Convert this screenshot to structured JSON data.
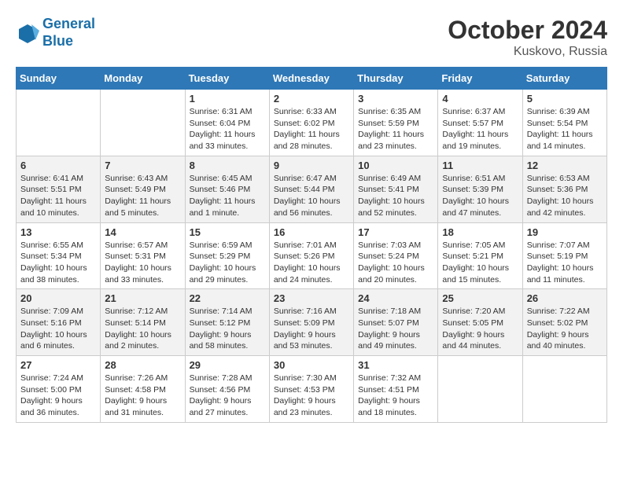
{
  "logo": {
    "line1": "General",
    "line2": "Blue"
  },
  "title": "October 2024",
  "location": "Kuskovo, Russia",
  "days_header": [
    "Sunday",
    "Monday",
    "Tuesday",
    "Wednesday",
    "Thursday",
    "Friday",
    "Saturday"
  ],
  "weeks": [
    [
      {
        "day": "",
        "info": ""
      },
      {
        "day": "",
        "info": ""
      },
      {
        "day": "1",
        "info": "Sunrise: 6:31 AM\nSunset: 6:04 PM\nDaylight: 11 hours and 33 minutes."
      },
      {
        "day": "2",
        "info": "Sunrise: 6:33 AM\nSunset: 6:02 PM\nDaylight: 11 hours and 28 minutes."
      },
      {
        "day": "3",
        "info": "Sunrise: 6:35 AM\nSunset: 5:59 PM\nDaylight: 11 hours and 23 minutes."
      },
      {
        "day": "4",
        "info": "Sunrise: 6:37 AM\nSunset: 5:57 PM\nDaylight: 11 hours and 19 minutes."
      },
      {
        "day": "5",
        "info": "Sunrise: 6:39 AM\nSunset: 5:54 PM\nDaylight: 11 hours and 14 minutes."
      }
    ],
    [
      {
        "day": "6",
        "info": "Sunrise: 6:41 AM\nSunset: 5:51 PM\nDaylight: 11 hours and 10 minutes."
      },
      {
        "day": "7",
        "info": "Sunrise: 6:43 AM\nSunset: 5:49 PM\nDaylight: 11 hours and 5 minutes."
      },
      {
        "day": "8",
        "info": "Sunrise: 6:45 AM\nSunset: 5:46 PM\nDaylight: 11 hours and 1 minute."
      },
      {
        "day": "9",
        "info": "Sunrise: 6:47 AM\nSunset: 5:44 PM\nDaylight: 10 hours and 56 minutes."
      },
      {
        "day": "10",
        "info": "Sunrise: 6:49 AM\nSunset: 5:41 PM\nDaylight: 10 hours and 52 minutes."
      },
      {
        "day": "11",
        "info": "Sunrise: 6:51 AM\nSunset: 5:39 PM\nDaylight: 10 hours and 47 minutes."
      },
      {
        "day": "12",
        "info": "Sunrise: 6:53 AM\nSunset: 5:36 PM\nDaylight: 10 hours and 42 minutes."
      }
    ],
    [
      {
        "day": "13",
        "info": "Sunrise: 6:55 AM\nSunset: 5:34 PM\nDaylight: 10 hours and 38 minutes."
      },
      {
        "day": "14",
        "info": "Sunrise: 6:57 AM\nSunset: 5:31 PM\nDaylight: 10 hours and 33 minutes."
      },
      {
        "day": "15",
        "info": "Sunrise: 6:59 AM\nSunset: 5:29 PM\nDaylight: 10 hours and 29 minutes."
      },
      {
        "day": "16",
        "info": "Sunrise: 7:01 AM\nSunset: 5:26 PM\nDaylight: 10 hours and 24 minutes."
      },
      {
        "day": "17",
        "info": "Sunrise: 7:03 AM\nSunset: 5:24 PM\nDaylight: 10 hours and 20 minutes."
      },
      {
        "day": "18",
        "info": "Sunrise: 7:05 AM\nSunset: 5:21 PM\nDaylight: 10 hours and 15 minutes."
      },
      {
        "day": "19",
        "info": "Sunrise: 7:07 AM\nSunset: 5:19 PM\nDaylight: 10 hours and 11 minutes."
      }
    ],
    [
      {
        "day": "20",
        "info": "Sunrise: 7:09 AM\nSunset: 5:16 PM\nDaylight: 10 hours and 6 minutes."
      },
      {
        "day": "21",
        "info": "Sunrise: 7:12 AM\nSunset: 5:14 PM\nDaylight: 10 hours and 2 minutes."
      },
      {
        "day": "22",
        "info": "Sunrise: 7:14 AM\nSunset: 5:12 PM\nDaylight: 9 hours and 58 minutes."
      },
      {
        "day": "23",
        "info": "Sunrise: 7:16 AM\nSunset: 5:09 PM\nDaylight: 9 hours and 53 minutes."
      },
      {
        "day": "24",
        "info": "Sunrise: 7:18 AM\nSunset: 5:07 PM\nDaylight: 9 hours and 49 minutes."
      },
      {
        "day": "25",
        "info": "Sunrise: 7:20 AM\nSunset: 5:05 PM\nDaylight: 9 hours and 44 minutes."
      },
      {
        "day": "26",
        "info": "Sunrise: 7:22 AM\nSunset: 5:02 PM\nDaylight: 9 hours and 40 minutes."
      }
    ],
    [
      {
        "day": "27",
        "info": "Sunrise: 7:24 AM\nSunset: 5:00 PM\nDaylight: 9 hours and 36 minutes."
      },
      {
        "day": "28",
        "info": "Sunrise: 7:26 AM\nSunset: 4:58 PM\nDaylight: 9 hours and 31 minutes."
      },
      {
        "day": "29",
        "info": "Sunrise: 7:28 AM\nSunset: 4:56 PM\nDaylight: 9 hours and 27 minutes."
      },
      {
        "day": "30",
        "info": "Sunrise: 7:30 AM\nSunset: 4:53 PM\nDaylight: 9 hours and 23 minutes."
      },
      {
        "day": "31",
        "info": "Sunrise: 7:32 AM\nSunset: 4:51 PM\nDaylight: 9 hours and 18 minutes."
      },
      {
        "day": "",
        "info": ""
      },
      {
        "day": "",
        "info": ""
      }
    ]
  ]
}
